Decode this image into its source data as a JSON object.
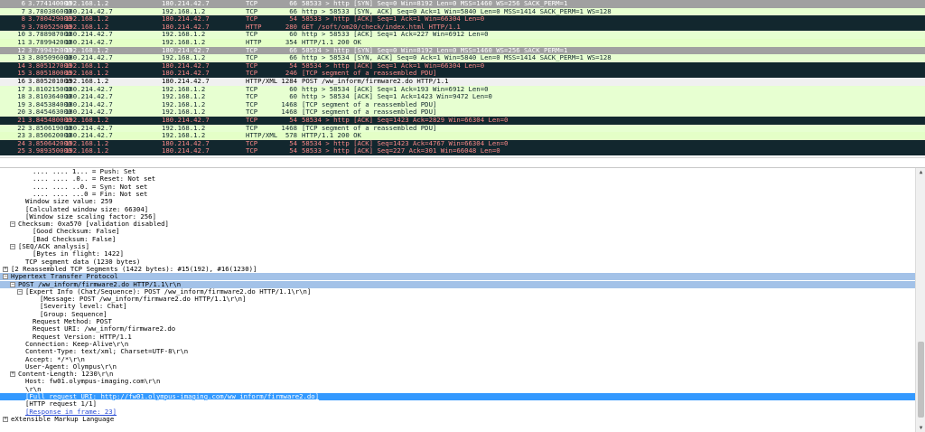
{
  "colors": {
    "syn_bg": "#a0a0a0",
    "syn_fg": "#ffffff",
    "data_bg": "#e7e6ff",
    "data_fg": "#12272e",
    "ack_bg": "#e7ffd1",
    "ack_fg": "#12272e",
    "http_bg": "#e4ffc7",
    "http_fg": "#12272e",
    "warn_bg": "#12272e",
    "warn_fg": "#f78787",
    "selected_bg": "#f0f0f0",
    "selected_fg": "#000000",
    "details_section_bg": "#a3c2e8",
    "details_selected_bg": "#3399ff"
  },
  "packet_list": {
    "rows": [
      {
        "no": "6",
        "time": "3.774140000",
        "src": "192.168.1.2",
        "dst": "180.214.42.7",
        "proto": "TCP",
        "len": "66",
        "info": "58533 > http [SYN] Seq=0 Win=8192 Len=0 MSS=1460 WS=256 SACK_PERM=1",
        "style": "syn"
      },
      {
        "no": "7",
        "time": "3.780386000",
        "src": "180.214.42.7",
        "dst": "192.168.1.2",
        "proto": "TCP",
        "len": "66",
        "info": "http > 58533 [SYN, ACK] Seq=0 Ack=1 Win=5840 Len=0 MSS=1414 SACK_PERM=1 WS=128",
        "style": "ack"
      },
      {
        "no": "8",
        "time": "3.780429000",
        "src": "192.168.1.2",
        "dst": "180.214.42.7",
        "proto": "TCP",
        "len": "54",
        "info": "58533 > http [ACK] Seq=1 Ack=1 Win=66304 Len=0",
        "style": "warn"
      },
      {
        "no": "9",
        "time": "3.780525000",
        "src": "192.168.1.2",
        "dst": "180.214.42.7",
        "proto": "HTTP",
        "len": "280",
        "info": "GET /soft/om20/check/index.html HTTP/1.1",
        "style": "warn"
      },
      {
        "no": "10",
        "time": "3.788987000",
        "src": "180.214.42.7",
        "dst": "192.168.1.2",
        "proto": "TCP",
        "len": "60",
        "info": "http > 58533 [ACK] Seq=1 Ack=227 Win=6912 Len=0",
        "style": "ack"
      },
      {
        "no": "11",
        "time": "3.789942000",
        "src": "180.214.42.7",
        "dst": "192.168.1.2",
        "proto": "HTTP",
        "len": "354",
        "info": "HTTP/1.1 200 OK",
        "style": "http"
      },
      {
        "no": "12",
        "time": "3.799412000",
        "src": "192.168.1.2",
        "dst": "180.214.42.7",
        "proto": "TCP",
        "len": "66",
        "info": "58534 > http [SYN] Seq=0 Win=8192 Len=0 MSS=1460 WS=256 SACK_PERM=1",
        "style": "syn"
      },
      {
        "no": "13",
        "time": "3.805096000",
        "src": "180.214.42.7",
        "dst": "192.168.1.2",
        "proto": "TCP",
        "len": "66",
        "info": "http > 58534 [SYN, ACK] Seq=0 Ack=1 Win=5840 Len=0 MSS=1414 SACK_PERM=1 WS=128",
        "style": "ack"
      },
      {
        "no": "14",
        "time": "3.805127000",
        "src": "192.168.1.2",
        "dst": "180.214.42.7",
        "proto": "TCP",
        "len": "54",
        "info": "58534 > http [ACK] Seq=1 Ack=1 Win=66304 Len=0",
        "style": "warn"
      },
      {
        "no": "15",
        "time": "3.805180000",
        "src": "192.168.1.2",
        "dst": "180.214.42.7",
        "proto": "TCP",
        "len": "246",
        "info": "[TCP segment of a reassembled PDU]",
        "style": "warn"
      },
      {
        "no": "16",
        "time": "3.805201000",
        "src": "192.168.1.2",
        "dst": "180.214.42.7",
        "proto": "HTTP/XML",
        "len": "1284",
        "info": "POST /ww_inform/firmware2.do HTTP/1.1",
        "style": "selected"
      },
      {
        "no": "17",
        "time": "3.810215000",
        "src": "180.214.42.7",
        "dst": "192.168.1.2",
        "proto": "TCP",
        "len": "60",
        "info": "http > 58534 [ACK] Seq=1 Ack=193 Win=6912 Len=0",
        "style": "ack"
      },
      {
        "no": "18",
        "time": "3.810364000",
        "src": "180.214.42.7",
        "dst": "192.168.1.2",
        "proto": "TCP",
        "len": "60",
        "info": "http > 58534 [ACK] Seq=1 Ack=1423 Win=9472 Len=0",
        "style": "ack"
      },
      {
        "no": "19",
        "time": "3.845384000",
        "src": "180.214.42.7",
        "dst": "192.168.1.2",
        "proto": "TCP",
        "len": "1468",
        "info": "[TCP segment of a reassembled PDU]",
        "style": "ack"
      },
      {
        "no": "20",
        "time": "3.845463000",
        "src": "180.214.42.7",
        "dst": "192.168.1.2",
        "proto": "TCP",
        "len": "1468",
        "info": "[TCP segment of a reassembled PDU]",
        "style": "ack"
      },
      {
        "no": "21",
        "time": "3.845480000",
        "src": "192.168.1.2",
        "dst": "180.214.42.7",
        "proto": "TCP",
        "len": "54",
        "info": "58534 > http [ACK] Seq=1423 Ack=2829 Win=66304 Len=0",
        "style": "warn"
      },
      {
        "no": "22",
        "time": "3.850619000",
        "src": "180.214.42.7",
        "dst": "192.168.1.2",
        "proto": "TCP",
        "len": "1468",
        "info": "[TCP segment of a reassembled PDU]",
        "style": "ack"
      },
      {
        "no": "23",
        "time": "3.850620000",
        "src": "180.214.42.7",
        "dst": "192.168.1.2",
        "proto": "HTTP/XML",
        "len": "578",
        "info": "HTTP/1.1 200 OK",
        "style": "http"
      },
      {
        "no": "24",
        "time": "3.850642000",
        "src": "192.168.1.2",
        "dst": "180.214.42.7",
        "proto": "TCP",
        "len": "54",
        "info": "58534 > http [ACK] Seq=1423 Ack=4767 Win=66304 Len=0",
        "style": "warn"
      },
      {
        "no": "25",
        "time": "3.989350000",
        "src": "192.168.1.2",
        "dst": "180.214.42.7",
        "proto": "TCP",
        "len": "54",
        "info": "58533 > http [ACK] Seq=227 Ack=301 Win=66048 Len=0",
        "style": "warn"
      }
    ]
  },
  "details": {
    "rows": [
      {
        "indent": 3,
        "text": ".... .... 1... = Push: Set",
        "expander": "",
        "style": ""
      },
      {
        "indent": 3,
        "text": ".... .... .0.. = Reset: Not set",
        "expander": "",
        "style": ""
      },
      {
        "indent": 3,
        "text": ".... .... ..0. = Syn: Not set",
        "expander": "",
        "style": ""
      },
      {
        "indent": 3,
        "text": ".... .... ...0 = Fin: Not set",
        "expander": "",
        "style": ""
      },
      {
        "indent": 2,
        "text": "Window size value: 259",
        "expander": "",
        "style": ""
      },
      {
        "indent": 2,
        "text": "[Calculated window size: 66304]",
        "expander": "",
        "style": ""
      },
      {
        "indent": 2,
        "text": "[Window size scaling factor: 256]",
        "expander": "",
        "style": ""
      },
      {
        "indent": 1,
        "text": "Checksum: 0xa570 [validation disabled]",
        "expander": "-",
        "style": ""
      },
      {
        "indent": 3,
        "text": "[Good Checksum: False]",
        "expander": "",
        "style": ""
      },
      {
        "indent": 3,
        "text": "[Bad Checksum: False]",
        "expander": "",
        "style": ""
      },
      {
        "indent": 1,
        "text": "[SEQ/ACK analysis]",
        "expander": "-",
        "style": ""
      },
      {
        "indent": 3,
        "text": "[Bytes in flight: 1422]",
        "expander": "",
        "style": ""
      },
      {
        "indent": 2,
        "text": "TCP segment data (1230 bytes)",
        "expander": "",
        "style": ""
      },
      {
        "indent": 0,
        "text": "[2 Reassembled TCP Segments (1422 bytes): #15(192), #16(1230)]",
        "expander": "+",
        "style": ""
      },
      {
        "indent": 0,
        "text": "Hypertext Transfer Protocol",
        "expander": "-",
        "style": "section"
      },
      {
        "indent": 1,
        "text": "POST /ww_inform/firmware2.do HTTP/1.1\\r\\n",
        "expander": "-",
        "style": "section"
      },
      {
        "indent": 2,
        "text": "[Expert Info (Chat/Sequence): POST /ww_inform/firmware2.do HTTP/1.1\\r\\n]",
        "expander": "-",
        "style": ""
      },
      {
        "indent": 4,
        "text": "[Message: POST /ww_inform/firmware2.do HTTP/1.1\\r\\n]",
        "expander": "",
        "style": ""
      },
      {
        "indent": 4,
        "text": "[Severity level: Chat]",
        "expander": "",
        "style": ""
      },
      {
        "indent": 4,
        "text": "[Group: Sequence]",
        "expander": "",
        "style": ""
      },
      {
        "indent": 3,
        "text": "Request Method: POST",
        "expander": "",
        "style": ""
      },
      {
        "indent": 3,
        "text": "Request URI: /ww_inform/firmware2.do",
        "expander": "",
        "style": ""
      },
      {
        "indent": 3,
        "text": "Request Version: HTTP/1.1",
        "expander": "",
        "style": ""
      },
      {
        "indent": 2,
        "text": "Connection: Keep-Alive\\r\\n",
        "expander": "",
        "style": ""
      },
      {
        "indent": 2,
        "text": "Content-Type: text/xml; Charset=UTF-8\\r\\n",
        "expander": "",
        "style": ""
      },
      {
        "indent": 2,
        "text": "Accept: */*\\r\\n",
        "expander": "",
        "style": ""
      },
      {
        "indent": 2,
        "text": "User-Agent: Olympus\\r\\n",
        "expander": "",
        "style": ""
      },
      {
        "indent": 1,
        "text": "Content-Length: 1230\\r\\n",
        "expander": "+",
        "style": ""
      },
      {
        "indent": 2,
        "text": "Host: fw01.olympus-imaging.com\\r\\n",
        "expander": "",
        "style": ""
      },
      {
        "indent": 2,
        "text": "\\r\\n",
        "expander": "",
        "style": ""
      },
      {
        "indent": 2,
        "text": "[Full request URI: http://fw01.olympus-imaging.com/ww_inform/firmware2.do]",
        "expander": "",
        "style": "selected",
        "link": true
      },
      {
        "indent": 2,
        "text": "[HTTP request 1/1]",
        "expander": "",
        "style": ""
      },
      {
        "indent": 2,
        "text": "[Response in frame: 23]",
        "expander": "",
        "style": "",
        "link": true
      },
      {
        "indent": 0,
        "text": "eXtensible Markup Language",
        "expander": "+",
        "style": ""
      }
    ]
  }
}
